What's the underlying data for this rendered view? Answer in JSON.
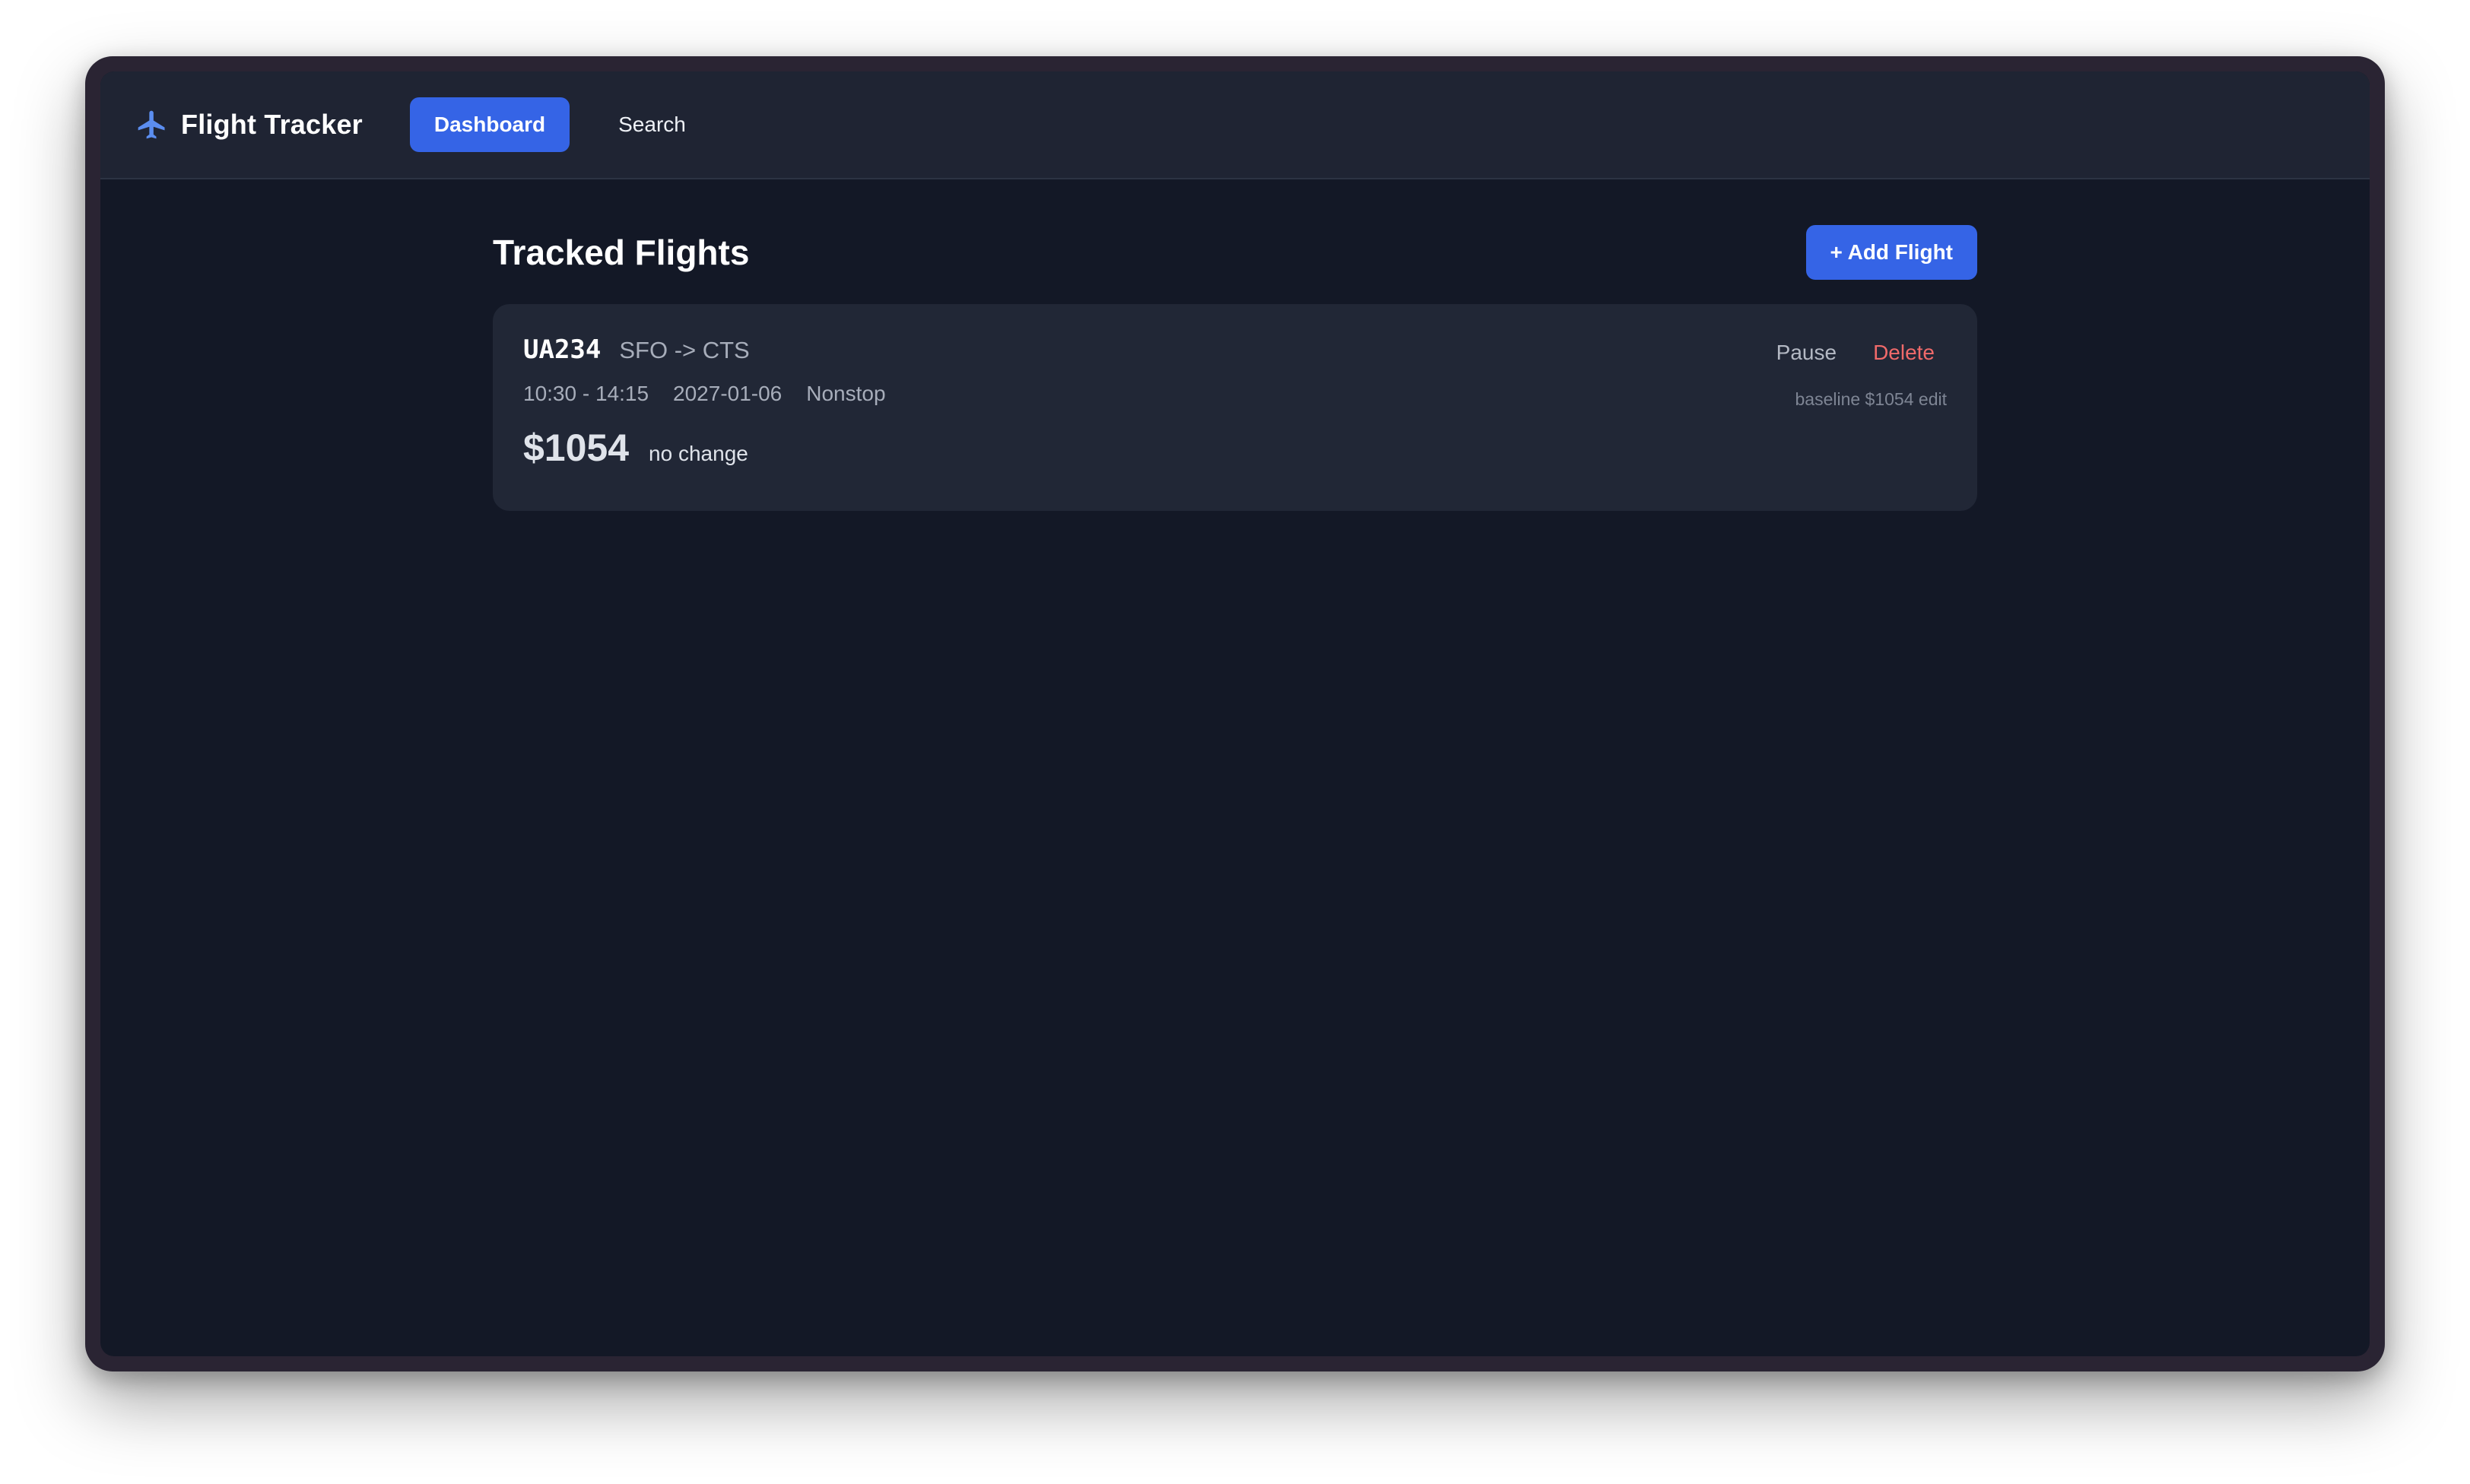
{
  "app": {
    "title": "Flight Tracker",
    "icon": "airplane-icon"
  },
  "nav": {
    "dashboard_label": "Dashboard",
    "search_label": "Search",
    "active": "Dashboard"
  },
  "main": {
    "title": "Tracked Flights",
    "add_button_label": "+ Add Flight"
  },
  "flights": [
    {
      "flight_number": "UA234",
      "route": "SFO -> CTS",
      "time": "10:30 - 14:15",
      "date": "2027-01-06",
      "stops": "Nonstop",
      "price": "$1054",
      "change": "no change",
      "pause_label": "Pause",
      "delete_label": "Delete",
      "baseline": "baseline $1054",
      "edit_label": "edit"
    }
  ],
  "colors": {
    "accent": "#3564e6",
    "danger": "#f06a6a",
    "background": "#131826",
    "card": "#212736"
  }
}
